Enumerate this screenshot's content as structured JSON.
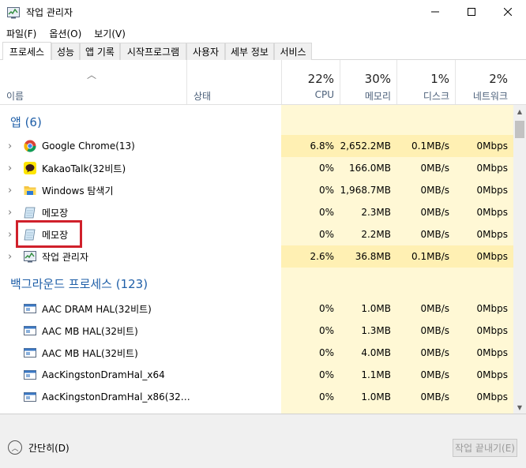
{
  "window": {
    "title": "작업 관리자",
    "controls": {
      "minimize_icon": "minimize-icon",
      "maximize_icon": "maximize-icon",
      "close_icon": "close-icon"
    }
  },
  "menu": [
    "파일(F)",
    "옵션(O)",
    "보기(V)"
  ],
  "tabs": [
    "프로세스",
    "성능",
    "앱 기록",
    "시작프로그램",
    "사용자",
    "세부 정보",
    "서비스"
  ],
  "header": {
    "name": "이름",
    "status": "상태",
    "cpu_pct": "22%",
    "cpu_label": "CPU",
    "mem_pct": "30%",
    "mem_label": "메모리",
    "disk_pct": "1%",
    "disk_label": "디스크",
    "net_pct": "2%",
    "net_label": "네트워크"
  },
  "groups": {
    "apps": "앱 (6)",
    "background": "백그라운드 프로세스 (123)"
  },
  "apps": [
    {
      "name": "Google Chrome(13)",
      "icon": "chrome-icon",
      "cpu": "6.8%",
      "mem": "2,652.2MB",
      "disk": "0.1MB/s",
      "net": "0Mbps"
    },
    {
      "name": "KakaoTalk(32비트)",
      "icon": "kakaotalk-icon",
      "cpu": "0%",
      "mem": "166.0MB",
      "disk": "0MB/s",
      "net": "0Mbps"
    },
    {
      "name": "Windows 탐색기",
      "icon": "explorer-folder-icon",
      "cpu": "0%",
      "mem": "1,968.7MB",
      "disk": "0MB/s",
      "net": "0Mbps"
    },
    {
      "name": "메모장",
      "icon": "notepad-icon",
      "cpu": "0%",
      "mem": "2.3MB",
      "disk": "0MB/s",
      "net": "0Mbps"
    },
    {
      "name": "메모장",
      "icon": "notepad-icon",
      "cpu": "0%",
      "mem": "2.2MB",
      "disk": "0MB/s",
      "net": "0Mbps"
    },
    {
      "name": "작업 관리자",
      "icon": "task-manager-icon",
      "cpu": "2.6%",
      "mem": "36.8MB",
      "disk": "0.1MB/s",
      "net": "0Mbps"
    }
  ],
  "background": [
    {
      "name": "AAC DRAM HAL(32비트)",
      "icon": "service-icon",
      "cpu": "0%",
      "mem": "1.0MB",
      "disk": "0MB/s",
      "net": "0Mbps"
    },
    {
      "name": "AAC MB HAL(32비트)",
      "icon": "service-icon",
      "cpu": "0%",
      "mem": "1.3MB",
      "disk": "0MB/s",
      "net": "0Mbps"
    },
    {
      "name": "AAC MB HAL(32비트)",
      "icon": "service-icon",
      "cpu": "0%",
      "mem": "4.0MB",
      "disk": "0MB/s",
      "net": "0Mbps"
    },
    {
      "name": "AacKingstonDramHal_x64",
      "icon": "service-icon",
      "cpu": "0%",
      "mem": "1.1MB",
      "disk": "0MB/s",
      "net": "0Mbps"
    },
    {
      "name": "AacKingstonDramHal_x86(32…",
      "icon": "service-icon",
      "cpu": "0%",
      "mem": "1.0MB",
      "disk": "0MB/s",
      "net": "0Mbps"
    }
  ],
  "footer": {
    "fewer_details": "간단히(D)",
    "end_task": "작업 끝내기(E)"
  },
  "colors": {
    "accent_blue": "#1f5fa8",
    "highlight_red": "#d0202b",
    "resource_bg": "#fff8d5",
    "resource_bg_active": "#fff0b3"
  }
}
